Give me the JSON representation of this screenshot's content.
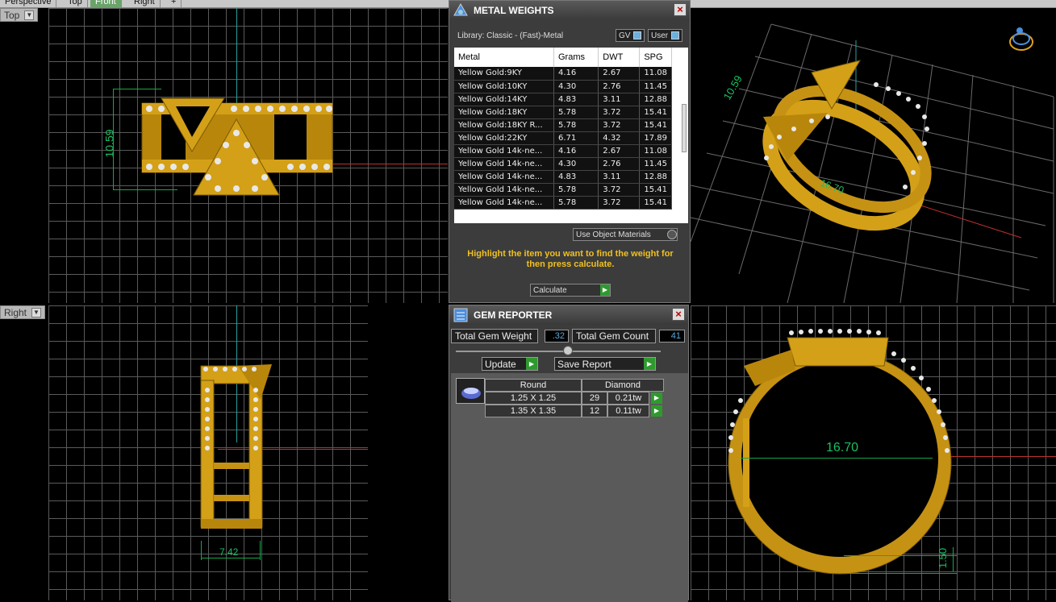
{
  "tabs": [
    "Perspective",
    "Top",
    "Front",
    "Right",
    "+"
  ],
  "viewports": {
    "top": {
      "label": "Top",
      "dimension": "10.59"
    },
    "right": {
      "label": "Right",
      "dimension": "7.42"
    },
    "perspective": {
      "dimension_a": "10.59",
      "dimension_b": "16.70"
    },
    "front": {
      "dimension_a": "16.70",
      "dimension_b": "1.50"
    }
  },
  "metal_weights": {
    "title": "METAL WEIGHTS",
    "library": "Library: Classic - (Fast)-Metal",
    "toggle_gv": "GV",
    "toggle_user": "User",
    "columns": [
      "Metal",
      "Grams",
      "DWT",
      "SPG"
    ],
    "rows": [
      [
        "Yellow Gold:9KY",
        "4.16",
        "2.67",
        "11.08"
      ],
      [
        "Yellow Gold:10KY",
        "4.30",
        "2.76",
        "11.45"
      ],
      [
        "Yellow Gold:14KY",
        "4.83",
        "3.11",
        "12.88"
      ],
      [
        "Yellow Gold:18KY",
        "5.78",
        "3.72",
        "15.41"
      ],
      [
        "Yellow Gold:18KY R...",
        "5.78",
        "3.72",
        "15.41"
      ],
      [
        "Yellow Gold:22KY",
        "6.71",
        "4.32",
        "17.89"
      ],
      [
        "Yellow Gold 14k-ne...",
        "4.16",
        "2.67",
        "11.08"
      ],
      [
        "Yellow Gold 14k-ne...",
        "4.30",
        "2.76",
        "11.45"
      ],
      [
        "Yellow Gold 14k-ne...",
        "4.83",
        "3.11",
        "12.88"
      ],
      [
        "Yellow Gold 14k-ne...",
        "5.78",
        "3.72",
        "15.41"
      ],
      [
        "Yellow Gold 14k-ne...",
        "5.78",
        "3.72",
        "15.41"
      ]
    ],
    "use_object_materials": "Use Object Materials",
    "instruction": "Highlight the item you want to find the weight for then press calculate.",
    "calculate": "Calculate"
  },
  "gem_reporter": {
    "title": "GEM REPORTER",
    "total_weight_label": "Total Gem Weight",
    "total_weight_value": ".32",
    "total_count_label": "Total Gem Count",
    "total_count_value": "41",
    "update": "Update",
    "save_report": "Save Report",
    "shape": "Round",
    "material": "Diamond",
    "rows": [
      {
        "size": "1.25 X 1.25",
        "count": "29",
        "tw": "0.21tw"
      },
      {
        "size": "1.35 X 1.35",
        "count": "12",
        "tw": "0.11tw"
      }
    ]
  },
  "colors": {
    "gold": "#d4a017",
    "grid": "#5a5a5a",
    "accent_yellow": "#f0c020",
    "go_green": "#2e9a2e"
  }
}
